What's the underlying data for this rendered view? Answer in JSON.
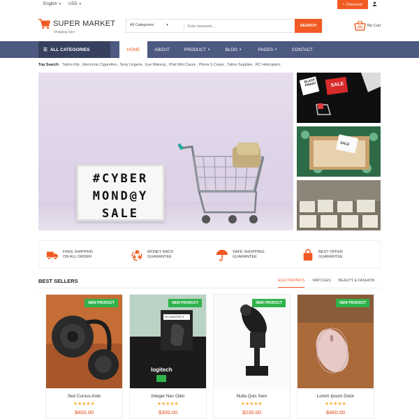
{
  "topbar": {
    "language": "English",
    "currency": "USD",
    "checkout_label": "Checkout",
    "icons": {
      "user": "user-icon",
      "checkout": "checkout-icon"
    }
  },
  "header": {
    "logo_title": "SUPER MARKET",
    "logo_subtitle": "Shopping store",
    "search": {
      "category_value": "All Categories",
      "placeholder": "Enter keywords...",
      "button_label": "SEARCH"
    },
    "cart_label": "My Cart"
  },
  "nav": {
    "all_categories_label": "ALL CATEGORIES",
    "items": [
      {
        "label": "HOME",
        "active": true,
        "dropdown": false
      },
      {
        "label": "ABOUT",
        "active": false,
        "dropdown": false
      },
      {
        "label": "PRODUCT",
        "active": false,
        "dropdown": true
      },
      {
        "label": "BLOG",
        "active": false,
        "dropdown": true
      },
      {
        "label": "PAGES",
        "active": false,
        "dropdown": true
      },
      {
        "label": "CONTACT",
        "active": false,
        "dropdown": false
      }
    ]
  },
  "top_search": {
    "label": "Top Search:",
    "terms": "Tattoo Kits , Electronic Cigarettes , Sexy Lingerie , Eye Makeup , iPad Mini Cases , Phone 5 Cases , Tattoo Supplies , RC Helicopters"
  },
  "banner": {
    "lightbox_lines": [
      "#CYBER",
      "MOND@Y",
      "SALE"
    ],
    "side_images": {
      "top_tags": [
        "BLACK FRIDAY",
        "SALE"
      ],
      "middle_tag": "SALE"
    }
  },
  "services": [
    {
      "line1": "FREE SHIPPING",
      "line2": "ON ALL ORDER",
      "icon": "truck-icon"
    },
    {
      "line1": "MONEY BACK",
      "line2": "GUARANTEE",
      "icon": "recycle-icon"
    },
    {
      "line1": "SAFE SHOPPING",
      "line2": "GUARANTEE",
      "icon": "umbrella-icon"
    },
    {
      "line1": "BEST OFFER",
      "line2": "GUARANTEE",
      "icon": "shopping-bag-icon"
    }
  ],
  "best_sellers": {
    "title": "BEST SELLERS",
    "tabs": [
      {
        "label": "ELECTRONICS",
        "active": true
      },
      {
        "label": "WATCHES",
        "active": false
      },
      {
        "label": "BEAUTY & FASHION",
        "active": false
      }
    ],
    "products": [
      {
        "badge": "NEW PRODUCT",
        "name": "Sed Cursus Ante",
        "stars": "★★★★★",
        "rating": 5,
        "price": "$400.00"
      },
      {
        "badge": "NEW PRODUCT",
        "name": "Integer Nec Odio",
        "stars": "★★★★★",
        "rating": 5,
        "price": "$300.00"
      },
      {
        "badge": "NEW PRODUCT",
        "name": "Nulla Quis Sem",
        "stars": "★★★★★",
        "rating": 5,
        "price": "$230.00"
      },
      {
        "badge": "NEW PRODUCT",
        "name": "Lorem Ipsum Dolor",
        "stars": "★★★★★",
        "rating": 5,
        "price": "$460.00"
      }
    ],
    "product_image_labels": {
      "mouse_box": "MX MASTER 3",
      "brand": "logitech"
    }
  },
  "colors": {
    "accent": "#f15a22",
    "nav": "#4c5a82",
    "nav_dark": "#37415f",
    "badge": "#2fb34c",
    "price": "#e3491b",
    "stars": "#f7a51c"
  }
}
